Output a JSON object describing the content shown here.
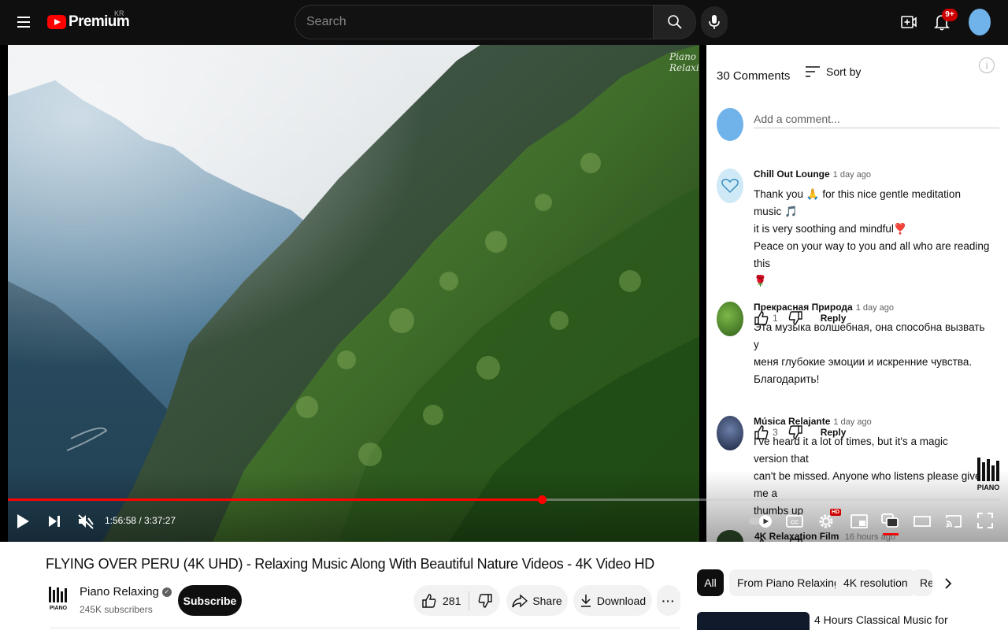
{
  "header": {
    "logo_text": "Premium",
    "region_label": "KR",
    "search_placeholder": "Search",
    "notification_count": "9+"
  },
  "player": {
    "watermark": "Piano Relaxing",
    "current_time": "1:56:58",
    "duration": "3:37:27",
    "time_display": "1:56:58 / 3:37:27",
    "progress_fraction": 0.538,
    "hd_label": "HD",
    "piano_logo_text": "PIANO"
  },
  "comments": {
    "count_label": "30 Comments",
    "sort_label": "Sort by",
    "add_placeholder": "Add a comment...",
    "reply_label": "Reply",
    "items": [
      {
        "author": "Chill Out Lounge",
        "time": "1 day ago",
        "lines": [
          "Thank you 🙏 for this nice gentle meditation music 🎵",
          "it is very soothing and mindful❣️",
          "Peace on your way to you and all who are reading this",
          "🌹"
        ],
        "likes": "1",
        "avatar_color": "#cfe9f7"
      },
      {
        "author": "Прекрасная Природа",
        "time": "1 day ago",
        "lines": [
          "Эта музыка волшебная, она способна вызвать у",
          "меня глубокие эмоции и искренние чувства.",
          "Благодарить!"
        ],
        "likes": "3",
        "avatar_color": "#3f7a2a"
      },
      {
        "author": "Música Relajante",
        "time": "1 day ago",
        "lines": [
          "I've heard it a lot of times, but it's a magic version that",
          "can't be missed. Anyone who listens please give me a",
          "thumbs up"
        ],
        "likes": "3",
        "avatar_color": "#2a3550"
      }
    ],
    "next_author": "4K Relaxation Film",
    "next_time": "16 hours ago"
  },
  "video": {
    "title": "FLYING OVER PERU (4K UHD) - Relaxing Music Along With Beautiful Nature Videos - 4K Video HD",
    "channel_name": "Piano Relaxing",
    "subscribers": "245K subscribers",
    "subscribe_label": "Subscribe",
    "likes": "281",
    "share_label": "Share",
    "download_label": "Download"
  },
  "recommendations": {
    "chips": [
      "All",
      "From Piano Relaxing",
      "4K resolution",
      "Re"
    ],
    "first_title": "4 Hours Classical Music for"
  },
  "colors": {
    "accent_red": "#ff0000",
    "badge_red": "#cc0000",
    "dark_bg": "#0f0f0f",
    "avatar_blue": "#6fb3ea"
  }
}
